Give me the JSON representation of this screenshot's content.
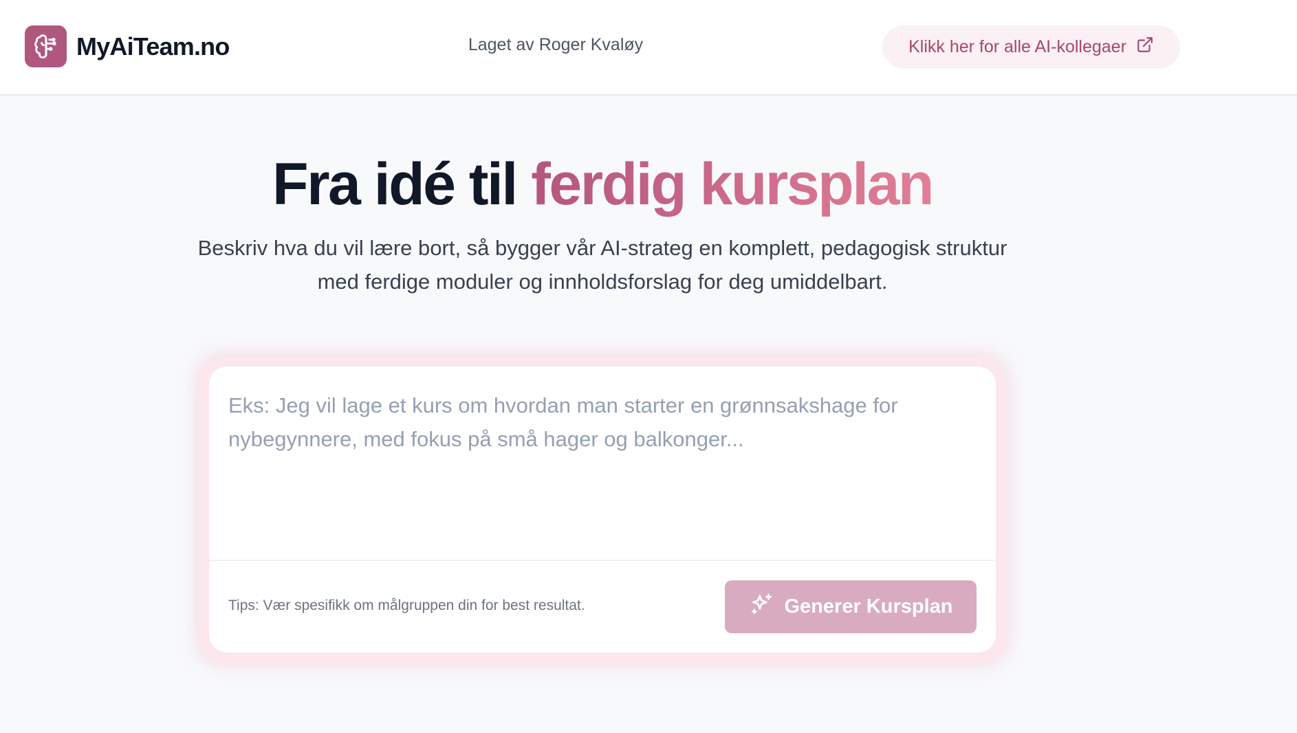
{
  "header": {
    "logo_text": "MyAiTeam.no",
    "logo_icon": "brain-icon",
    "credit": "Laget av Roger Kvaløy",
    "colleagues_link": "Klikk her for alle AI-kollegaer",
    "colleagues_icon": "external-link-icon"
  },
  "hero": {
    "title_plain": "Fra idé til ",
    "title_accent": "ferdig kursplan",
    "subtitle": "Beskriv hva du vil lære bort, så bygger vår AI-strateg en komplett, pedagogisk struktur med ferdige moduler og innholdsforslag for deg umiddelbart."
  },
  "prompt": {
    "placeholder": "Eks: Jeg vil lage et kurs om hvordan man starter en grønnsakshage for nybegynnere, med fokus på små hager og balkonger...",
    "value": "",
    "tips": "Tips: Vær spesifikk om målgruppen din for best resultat.",
    "button_label": "Generer Kursplan",
    "button_icon": "sparkles-icon"
  },
  "colors": {
    "brand": "#b0577f",
    "accent_start": "#b4557f",
    "accent_end": "#e27f95",
    "button_disabled": "#d9abc1"
  }
}
